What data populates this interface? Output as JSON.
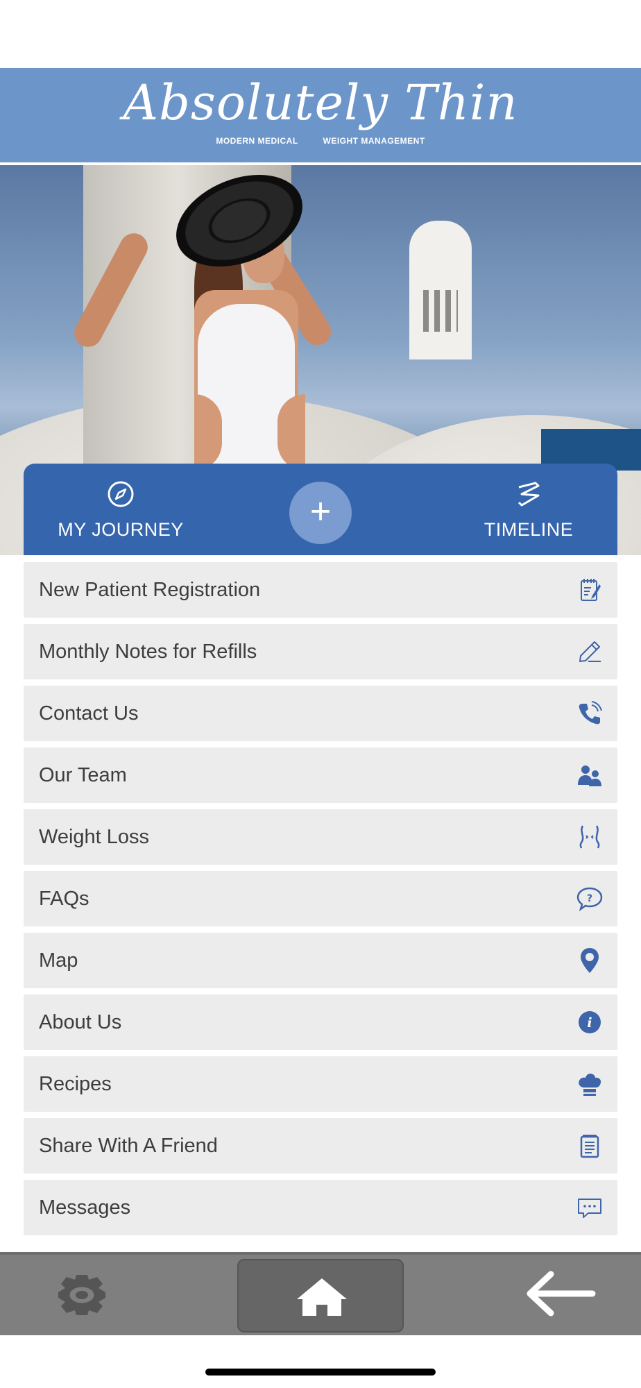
{
  "header": {
    "logo_title": "Absolutely Thin",
    "logo_sub_left": "MODERN MEDICAL",
    "logo_sub_right": "WEIGHT MANAGEMENT",
    "background_color": "#6c95c9"
  },
  "action_bar": {
    "background_color": "#3565ad",
    "journey_label": "MY JOURNEY",
    "journey_icon": "compass-icon",
    "add_label": "+",
    "timeline_label": "TIMELINE",
    "timeline_icon": "timeline-icon"
  },
  "menu": {
    "items": [
      {
        "label": "New Patient Registration",
        "icon": "notepad-icon"
      },
      {
        "label": "Monthly Notes for Refills",
        "icon": "pencil-icon"
      },
      {
        "label": "Contact Us",
        "icon": "phone-icon"
      },
      {
        "label": "Our Team",
        "icon": "team-icon"
      },
      {
        "label": "Weight Loss",
        "icon": "waist-icon"
      },
      {
        "label": "FAQs",
        "icon": "question-bubble-icon"
      },
      {
        "label": "Map",
        "icon": "map-pin-icon"
      },
      {
        "label": "About Us",
        "icon": "info-icon"
      },
      {
        "label": "Recipes",
        "icon": "chef-hat-icon"
      },
      {
        "label": "Share With A Friend",
        "icon": "document-icon"
      },
      {
        "label": "Messages",
        "icon": "chat-bubble-icon"
      }
    ],
    "icon_color": "#3e64a9"
  },
  "bottom_nav": {
    "settings_icon": "gear-icon",
    "home_icon": "home-icon",
    "back_icon": "back-arrow-icon"
  }
}
